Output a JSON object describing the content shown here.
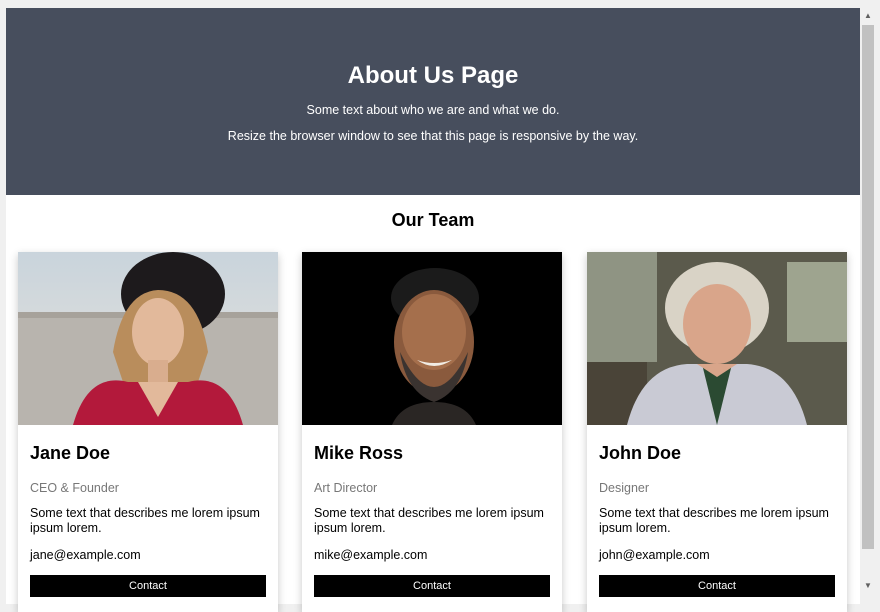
{
  "hero": {
    "title": "About Us Page",
    "line1": "Some text about who we are and what we do.",
    "line2": "Resize the browser window to see that this page is responsive by the way."
  },
  "team": {
    "heading": "Our Team",
    "members": [
      {
        "name": "Jane Doe",
        "title": "CEO & Founder",
        "description": "Some text that describes me lorem ipsum ipsum lorem.",
        "email": "jane@example.com",
        "contact_label": "Contact"
      },
      {
        "name": "Mike Ross",
        "title": "Art Director",
        "description": "Some text that describes me lorem ipsum ipsum lorem.",
        "email": "mike@example.com",
        "contact_label": "Contact"
      },
      {
        "name": "John Doe",
        "title": "Designer",
        "description": "Some text that describes me lorem ipsum ipsum lorem.",
        "email": "john@example.com",
        "contact_label": "Contact"
      }
    ]
  },
  "colors": {
    "hero_bg": "#474e5d",
    "button_bg": "#000000",
    "subtitle_text": "#777777"
  }
}
